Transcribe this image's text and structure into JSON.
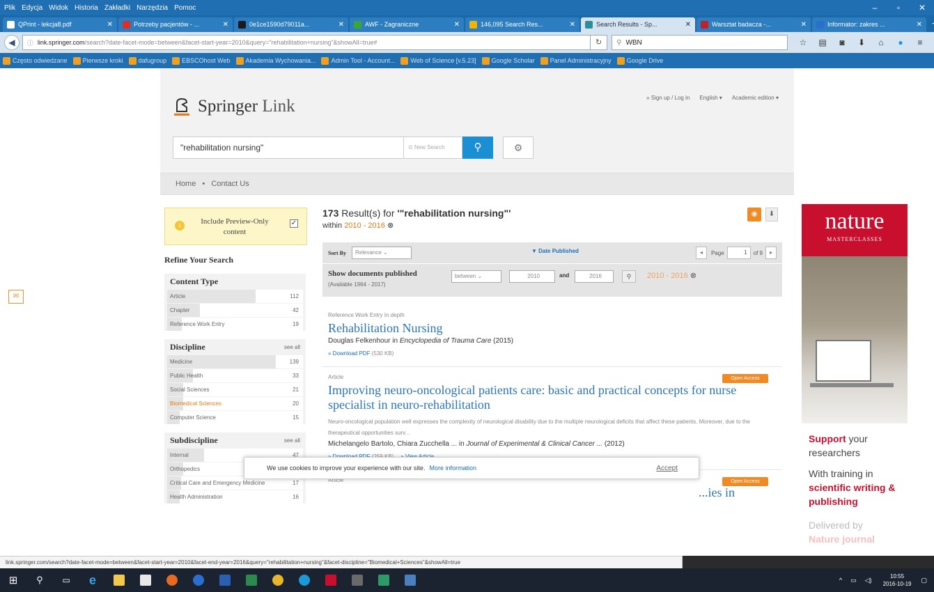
{
  "menubar": {
    "items": [
      "Plik",
      "Edycja",
      "Widok",
      "Historia",
      "Zakładki",
      "Narzędzia",
      "Pomoc"
    ]
  },
  "tabs": [
    {
      "label": "QPrint - lekcja8.pdf",
      "color": "#ffffff",
      "active": false
    },
    {
      "label": "Potrzeby pacjentów - ...",
      "color": "#d9302c",
      "active": false
    },
    {
      "label": "0e1ce1590d79011a...",
      "color": "#1a1a1a",
      "active": false
    },
    {
      "label": "AWF - Zagraniczne",
      "color": "#3aa63a",
      "active": false
    },
    {
      "label": "146,095 Search Res...",
      "color": "#f0b400",
      "active": false
    },
    {
      "label": "Search Results - Sp...",
      "color": "#2a8f9a",
      "active": true
    },
    {
      "label": "Warsztat badacza -...",
      "color": "#c0202a",
      "active": false
    },
    {
      "label": "Informator: zakres ...",
      "color": "#2a6fd0",
      "active": false
    }
  ],
  "nav": {
    "url_domain": "link.springer.com",
    "url_rest": "/search?date-facet-mode=between&facet-start-year=2010&query=\"rehabilitation+nursing\"&showAll=true#",
    "search_value": "WBN"
  },
  "bookmarks": [
    "Często odwiedzane",
    "Pierwsze kroki",
    "dafugroup",
    "EBSCOhost Web",
    "Akademia Wychowania...",
    "Admin Tool - Account...",
    "Web of Science [v.5.23]",
    "Google Scholar",
    "Panel Administracyjny",
    "Google Drive"
  ],
  "springer": {
    "logo_main": "Springer",
    "logo_link": "Link",
    "top_links": [
      "» Sign up / Log in",
      "English ▾",
      "Academic edition ▾"
    ],
    "search_value": "\"rehabilitation nursing\"",
    "new_search": "New Search",
    "crumbs": [
      "Home",
      "•",
      "Contact Us"
    ],
    "preview_label": "Include Preview-Only content",
    "refine_title": "Refine Your Search",
    "facets": [
      {
        "title": "Content Type",
        "see_all": "",
        "items": [
          {
            "label": "Article",
            "count": "112",
            "frac": 0.65,
            "hl": false
          },
          {
            "label": "Chapter",
            "count": "42",
            "frac": 0.24,
            "hl": false
          },
          {
            "label": "Reference Work Entry",
            "count": "19",
            "frac": 0.11,
            "hl": false
          }
        ]
      },
      {
        "title": "Discipline",
        "see_all": "see all",
        "items": [
          {
            "label": "Medicine",
            "count": "139",
            "frac": 0.8,
            "hl": false
          },
          {
            "label": "Public Health",
            "count": "33",
            "frac": 0.19,
            "hl": false
          },
          {
            "label": "Social Sciences",
            "count": "21",
            "frac": 0.12,
            "hl": false
          },
          {
            "label": "Biomedical Sciences",
            "count": "20",
            "frac": 0.12,
            "hl": true
          },
          {
            "label": "Computer Science",
            "count": "15",
            "frac": 0.09,
            "hl": false
          }
        ]
      },
      {
        "title": "Subdiscipline",
        "see_all": "see all",
        "items": [
          {
            "label": "Internal",
            "count": "47",
            "frac": 0.27,
            "hl": false
          },
          {
            "label": "Orthopedics",
            "count": "21",
            "frac": 0.12,
            "hl": false
          },
          {
            "label": "Critical Care and Emergency Medicine",
            "count": "17",
            "frac": 0.1,
            "hl": false
          },
          {
            "label": "Health Administration",
            "count": "16",
            "frac": 0.09,
            "hl": false
          }
        ]
      }
    ],
    "results_count": "173",
    "results_text": " Result(s) for ",
    "results_query": "'\"rehabilitation nursing\"'",
    "within_text": "within ",
    "within_years": "2010 - 2016",
    "sort_label": "Sort By",
    "sort_value": "Relevance",
    "date_published": "▼ Date Published",
    "page_label": "Page",
    "page_value": "1",
    "page_of": "of 9",
    "show_docs": "Show documents published",
    "date_mode": "between",
    "from_year": "2010",
    "and_label": "and",
    "to_year": "2016",
    "available": "(Available 1964 - 2017)",
    "date_range": "2010 - 2016",
    "results": [
      {
        "meta": "Reference Work Entry  In depth",
        "title": "Rehabilitation Nursing",
        "snippet": "",
        "authors": "Douglas Felkenhour in ",
        "source": "Encyclopedia of Trauma Care",
        "year": " (2015)",
        "download": "» Download PDF",
        "size": " (530 KB)",
        "view": "",
        "open_access": ""
      },
      {
        "meta": "Article",
        "title": "Improving neuro-oncological patients care: basic and practical concepts for nurse specialist in neuro-rehabilitation",
        "snippet": "Neuro-oncological population well expresses the complexity of neurological disability due to the multiple neurological deficits that affect these patients. Moreover, due to the therapeutical opportunities surv...",
        "authors": "Michelangelo Bartolo, Chiara Zucchella ... in ",
        "source": "Journal of Experimental & Clinical Cancer ...",
        "year": " (2012)",
        "download": "» Download PDF",
        "size": " (259 KB)",
        "view": "» View Article",
        "open_access": "Open Access"
      },
      {
        "meta": "Article",
        "title": "...ies in",
        "snippet": "",
        "authors": "",
        "source": "",
        "year": "",
        "download": "",
        "size": "",
        "view": "",
        "open_access": "Open Access"
      }
    ],
    "cookie_msg": "We use cookies to improve your experience with our site.",
    "cookie_more": "More information",
    "cookie_accept": "Accept"
  },
  "ad": {
    "brand": "nature",
    "sub": "MASTERCLASSES",
    "support": "Support",
    "your": " your",
    "researchers": "researchers",
    "with_training": "With training in",
    "scientific_writing": "scientific writing & publishing",
    "delivered_by": "Delivered by",
    "nature_journal": "Nature journal"
  },
  "status_url": "link.springer.com/search?date-facet-mode=between&facet-start-year=2010&facet-end-year=2016&query=\"rehabilitation+nursing\"&facet-discipline=\"Biomedical+Sciences\"&showAll=true",
  "clock": {
    "time": "10:55",
    "date": "2016-10-19"
  },
  "colors": {
    "firefox_blue": "#1f6fb2",
    "springer_blue": "#2c76b6",
    "accent_orange": "#f08a24",
    "nature_red": "#c8102e"
  }
}
